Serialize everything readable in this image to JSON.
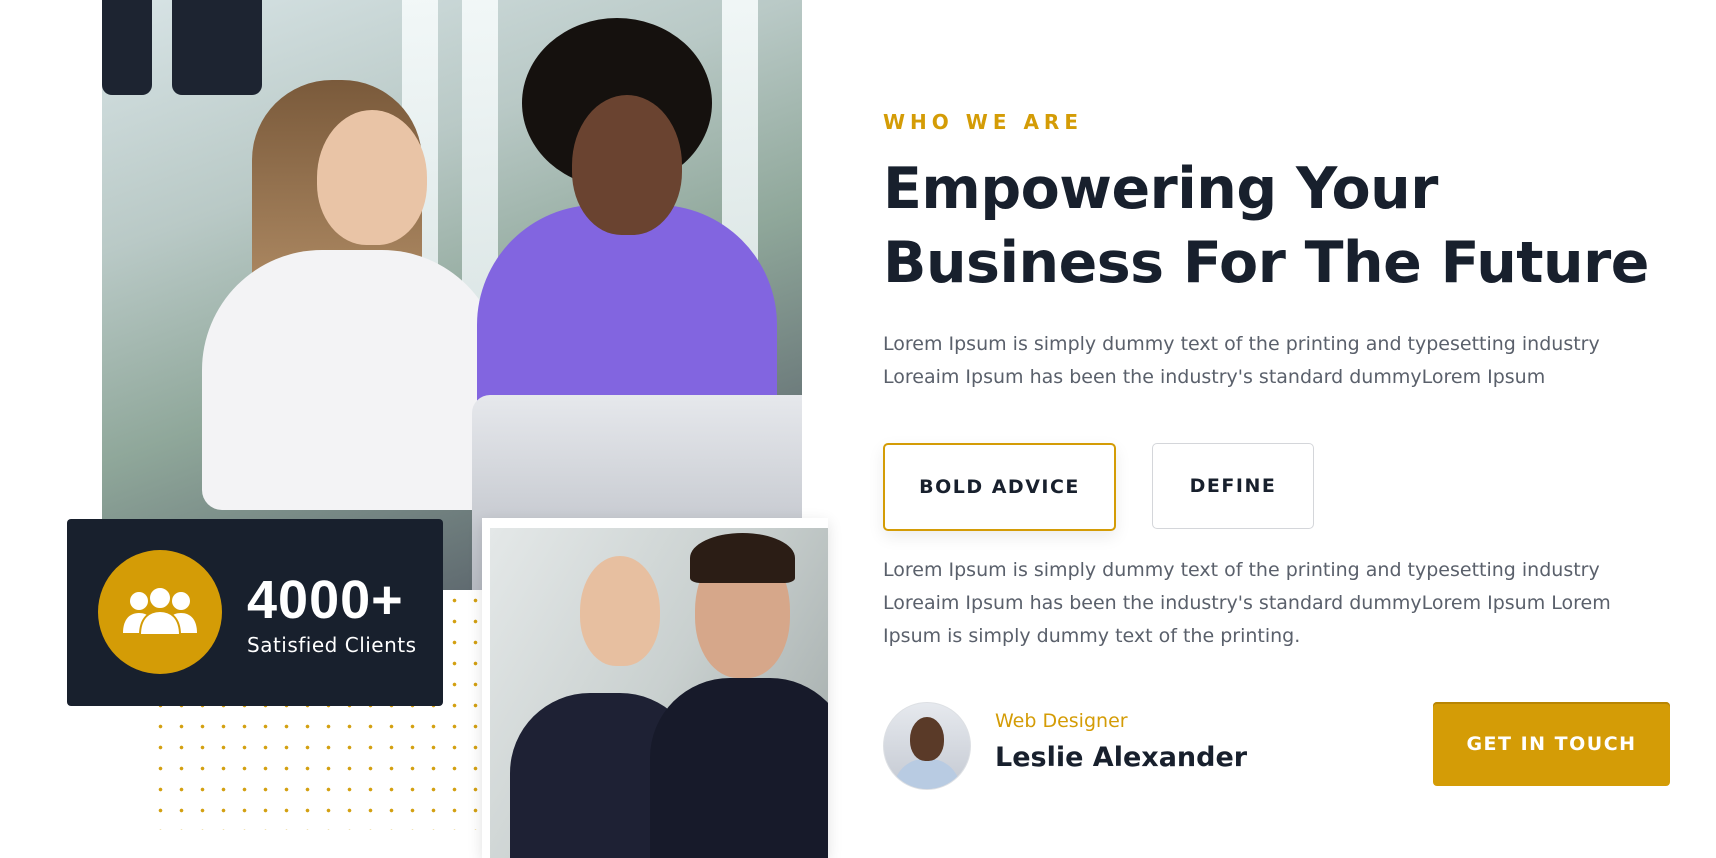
{
  "about": {
    "eyebrow": "WHO WE ARE",
    "headline": "Empowering Your Business For The Future",
    "paragraph_1": "Lorem Ipsum is simply dummy text of the printing and typesetting industry Loreaim Ipsum has been the industry's standard dummyLorem Ipsum",
    "tabs": [
      {
        "label": "BOLD ADVICE",
        "active": true
      },
      {
        "label": "DEFINE",
        "active": false
      }
    ],
    "paragraph_2": "Lorem Ipsum is simply dummy text of the printing and typesetting industry Loreaim Ipsum has been the industry's standard dummyLorem Ipsum Lorem Ipsum is simply dummy text of the printing."
  },
  "stats": {
    "icon": "users-icon",
    "number": "4000+",
    "label": "Satisfied Clients"
  },
  "author": {
    "role": "Web Designer",
    "name": "Leslie Alexander"
  },
  "cta": {
    "label": "GET IN TOUCH"
  },
  "colors": {
    "accent": "#d49c06",
    "dark": "#18202d",
    "text": "#5a606b"
  }
}
